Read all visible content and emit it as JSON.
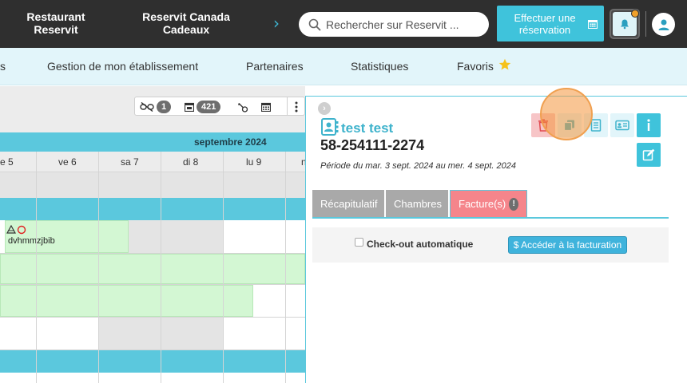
{
  "topbar": {
    "link_restaurant_line1": "Restaurant",
    "link_restaurant_line2": "Reservit",
    "link_canada_line1": "Reservit Canada",
    "link_canada_line2": "Cadeaux",
    "arrow": "›",
    "search_placeholder": "Rechercher sur Reservit ...",
    "reserve_button": "Effectuer une réservation"
  },
  "nav": {
    "cut_item": "s",
    "items": [
      "Gestion de mon établissement",
      "Partenaires",
      "Statistiques",
      "Favoris"
    ]
  },
  "calendar": {
    "tool_badge_1": "1",
    "tool_badge_421": "421",
    "month": "septembre 2024",
    "days": [
      "e 5",
      "ve 6",
      "sa 7",
      "di 8",
      "lu 9",
      "n"
    ],
    "booking_label": "dvhmmzjbib"
  },
  "panel": {
    "collapse": "›",
    "client_name": "test test",
    "reservation_number": "58-254111-2274",
    "period": "Période du mar. 3 sept. 2024 au mer. 4 sept. 2024",
    "tabs": [
      "Récapitulatif",
      "Chambres",
      "Facture(s)"
    ],
    "tab_warning": "!",
    "checkout_label": "Check-out automatique",
    "billing_button": "$ Accéder à la facturation"
  },
  "colors": {
    "topbar": "#2f2f2f",
    "accent": "#3fc3db",
    "nav_bg": "#e2f5fa",
    "booking_green": "#d3f7d3",
    "invoice_tab": "#f5858b",
    "highlight": "#f4963c"
  },
  "icons": {
    "search": "search-icon",
    "calendar": "calendar-icon",
    "bell": "bell-icon",
    "user": "user-icon",
    "star": "star-icon",
    "delete": "trash-icon",
    "copy": "copy-icon",
    "print": "document-icon",
    "card": "id-card-icon",
    "info": "info-icon",
    "edit": "edit-icon",
    "contact": "contact-card-icon"
  }
}
